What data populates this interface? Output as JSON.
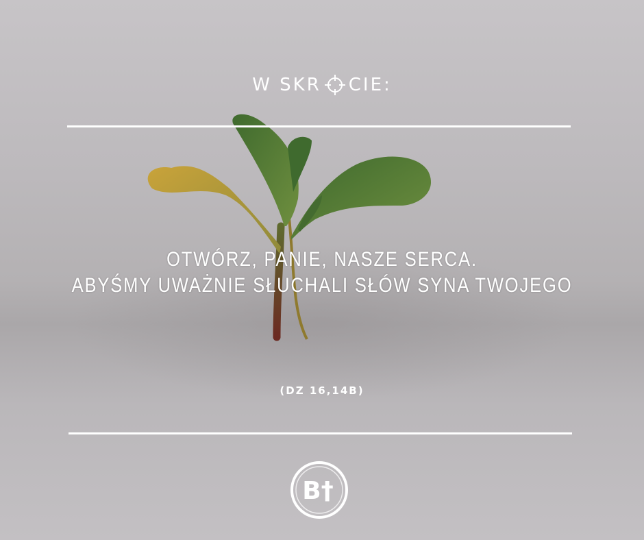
{
  "header": {
    "title_left": "W SKR",
    "title_right": "CIE:",
    "title_icon": "crosshair-icon"
  },
  "quote": {
    "line1": "OTWÓRZ, PANIE, NASZE SERCA.",
    "line2": "ABYŚMY UWAŻNIE SŁUCHALI SŁÓW SYNA TWOJEGO"
  },
  "reference": "(DZ 16,14B)",
  "logo": {
    "text": "B†",
    "icon": "bt-logo-icon"
  },
  "colors": {
    "text": "#ffffff",
    "background": "#bdbabd",
    "leaf_green": "#4f7a3a",
    "leaf_yellow": "#c9a33a"
  }
}
